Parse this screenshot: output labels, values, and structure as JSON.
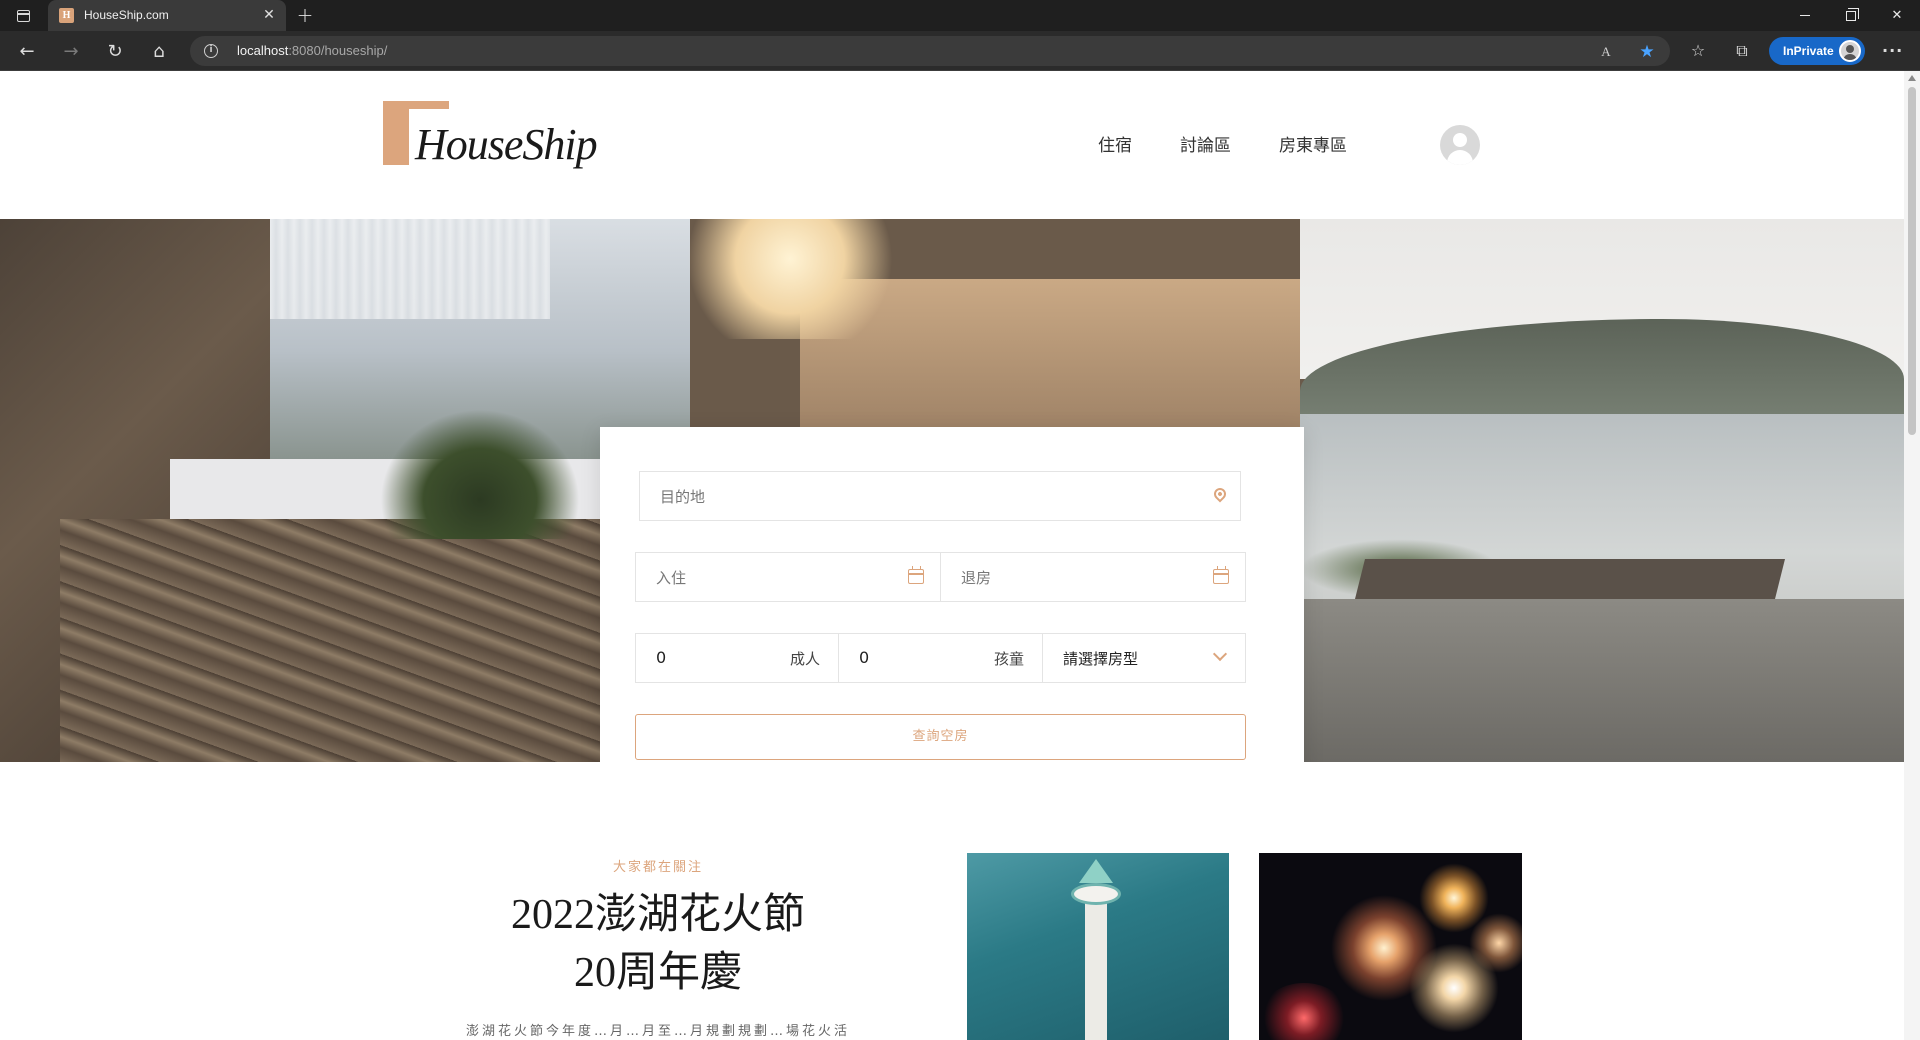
{
  "browser": {
    "tab_title": "HouseShip.com",
    "tab_favicon_letter": "H",
    "url_host": "localhost",
    "url_rest": ":8080/houseship/",
    "inprivate_label": "InPrivate",
    "fav_star_color": "#4aa3ff",
    "inprivate_color": "#1868c8"
  },
  "header": {
    "logo_text": "HouseShip",
    "nav": [
      "住宿",
      "討論區",
      "房東專區"
    ]
  },
  "search": {
    "destination_placeholder": "目的地",
    "checkin_placeholder": "入住",
    "checkout_placeholder": "退房",
    "adults_value": "0",
    "adults_unit": "成人",
    "children_value": "0",
    "children_unit": "孩童",
    "room_type": "請選擇房型",
    "submit_label": "查詢空房"
  },
  "carousel": {
    "slide_count": 3,
    "active_index": 1
  },
  "feature": {
    "eyebrow": "大家都在關注",
    "title_line1": "2022澎湖花火節",
    "title_line2": "20周年慶",
    "description": "澎湖花火節今年度…月…月至…月規劃規劃…場花火活"
  },
  "colors": {
    "accent": "#dca57d",
    "text_dark": "#1a1a1a"
  }
}
